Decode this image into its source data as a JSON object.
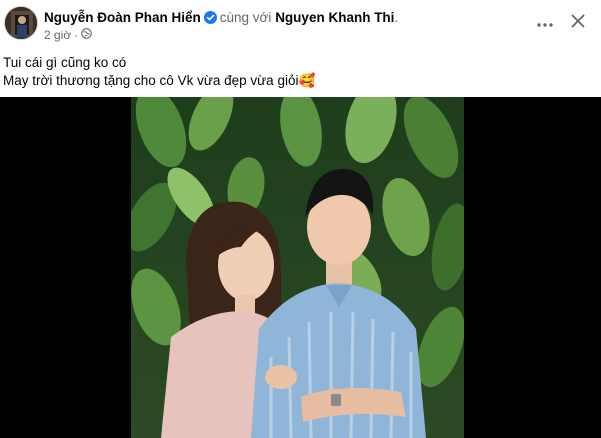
{
  "post": {
    "author": "Nguyễn Đoàn Phan Hiển",
    "with_text": "cùng với",
    "tagged": "Nguyen Khanh Thi",
    "period": ".",
    "time": "2 giờ",
    "privacy_icon": "globe-icon",
    "caption_lines": [
      "Tui cái gì cũng ko có",
      "May trời thương tặng cho cô Vk vừa đẹp vừa giỏi🥰"
    ]
  },
  "actions": {
    "more_icon": "more-horizontal-icon",
    "close_icon": "close-icon"
  },
  "colors": {
    "verified_badge": "#1877f2",
    "secondary_text": "#65676b",
    "photo_background": "#000000"
  }
}
